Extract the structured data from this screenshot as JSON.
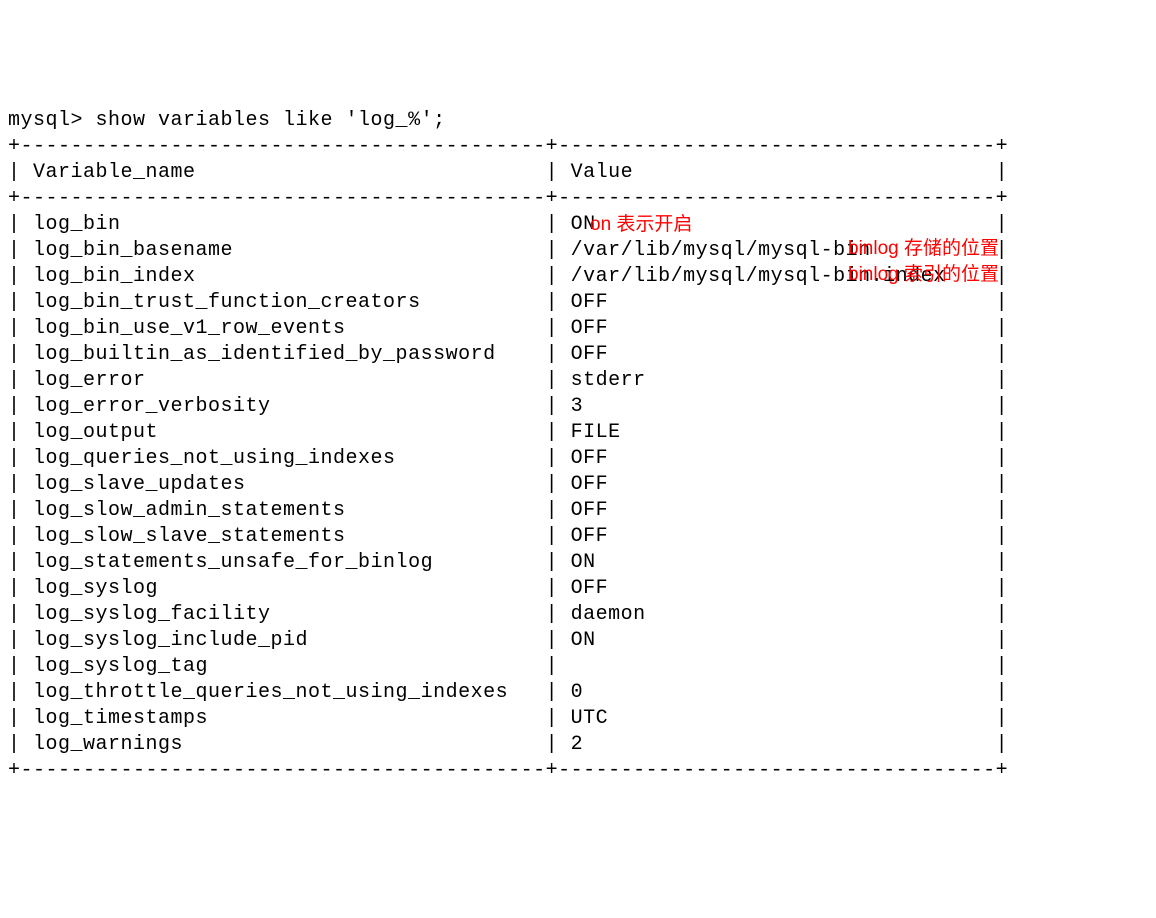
{
  "prompt": "mysql> show variables like 'log_%';",
  "header": {
    "col1": "Variable_name",
    "col2": "Value"
  },
  "rows": [
    {
      "name": "log_bin",
      "value": "ON"
    },
    {
      "name": "log_bin_basename",
      "value": "/var/lib/mysql/mysql-bin"
    },
    {
      "name": "log_bin_index",
      "value": "/var/lib/mysql/mysql-bin.index"
    },
    {
      "name": "log_bin_trust_function_creators",
      "value": "OFF"
    },
    {
      "name": "log_bin_use_v1_row_events",
      "value": "OFF"
    },
    {
      "name": "log_builtin_as_identified_by_password",
      "value": "OFF"
    },
    {
      "name": "log_error",
      "value": "stderr"
    },
    {
      "name": "log_error_verbosity",
      "value": "3"
    },
    {
      "name": "log_output",
      "value": "FILE"
    },
    {
      "name": "log_queries_not_using_indexes",
      "value": "OFF"
    },
    {
      "name": "log_slave_updates",
      "value": "OFF"
    },
    {
      "name": "log_slow_admin_statements",
      "value": "OFF"
    },
    {
      "name": "log_slow_slave_statements",
      "value": "OFF"
    },
    {
      "name": "log_statements_unsafe_for_binlog",
      "value": "ON"
    },
    {
      "name": "log_syslog",
      "value": "OFF"
    },
    {
      "name": "log_syslog_facility",
      "value": "daemon"
    },
    {
      "name": "log_syslog_include_pid",
      "value": "ON"
    },
    {
      "name": "log_syslog_tag",
      "value": ""
    },
    {
      "name": "log_throttle_queries_not_using_indexes",
      "value": "0"
    },
    {
      "name": "log_timestamps",
      "value": "UTC"
    },
    {
      "name": "log_warnings",
      "value": "2"
    }
  ],
  "annotations": {
    "a1": "on 表示开启",
    "a2": "binlog 存储的位置",
    "a3": "binlog 索引的位置"
  },
  "layout": {
    "col1_width": 40,
    "col2_width": 33
  }
}
